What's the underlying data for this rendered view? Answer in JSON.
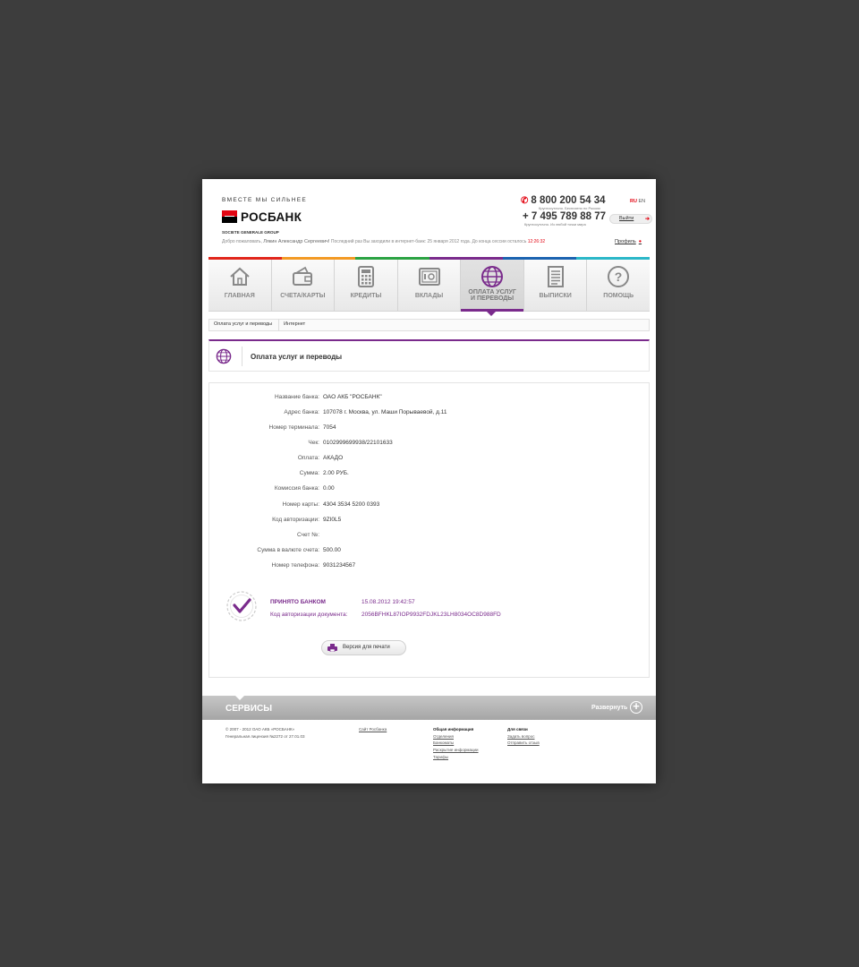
{
  "header": {
    "slogan": "ВМЕСТЕ МЫ СИЛЬНЕЕ",
    "logo_text": "РОСБАНК",
    "group": "SOCIETE GENERALE GROUP",
    "phone1": "8 800 200 54 34",
    "phone1_note": "Круглосуточно. Бесплатно по России",
    "phone2": "+ 7 495 789 88 77",
    "phone2_note": "Круглосуточно. Из любой точки мира",
    "lang_ru": "RU",
    "lang_en": "EN",
    "logout": "Выйти",
    "welcome_prefix": "Добро пожаловать,",
    "user_name": "Лякин Александр Сергеевич!",
    "last_login": "Последний раз Вы заходили в интернет-банк: 25 января 2012 года.",
    "session_label": "До конца сессии осталось",
    "session_time": "12:26:32",
    "profile": "Профиль"
  },
  "colors": {
    "accent": "#7a2b8c",
    "brand_red": "#e30613",
    "stripe": [
      "#e1261c",
      "#f39a24",
      "#2ca343",
      "#7a2b8c",
      "#1b63b0",
      "#2bb7c8"
    ]
  },
  "nav": [
    {
      "label": "ГЛАВНАЯ",
      "icon": "home-icon"
    },
    {
      "label": "СЧЕТА/КАРТЫ",
      "icon": "wallet-icon"
    },
    {
      "label": "КРЕДИТЫ",
      "icon": "calculator-icon"
    },
    {
      "label": "ВКЛАДЫ",
      "icon": "safe-icon"
    },
    {
      "label": "ОПЛАТА УСЛУГ",
      "label2": "И ПЕРЕВОДЫ",
      "icon": "globe-icon",
      "active": true
    },
    {
      "label": "ВЫПИСКИ",
      "icon": "document-icon"
    },
    {
      "label": "ПОМОЩЬ",
      "icon": "help-icon"
    }
  ],
  "breadcrumb": [
    "Оплата услуг и переводы",
    "Интернет"
  ],
  "section_title": "Оплата услуг и переводы",
  "receipt": [
    {
      "label": "Название банка:",
      "value": "ОАО АКБ \"РОСБАНК\""
    },
    {
      "label": "Адрес банка:",
      "value": "107078 г. Москва, ул. Маши Порываевой, д.11"
    },
    {
      "label": "Номер терминала:",
      "value": "7054"
    },
    {
      "label": "Чек:",
      "value": "0102999699938/22101633"
    },
    {
      "label": "Оплата:",
      "value": "АКАДО"
    },
    {
      "label": "Сумма:",
      "value": "2.00 РУБ."
    },
    {
      "label": "Комиссия банка:",
      "value": "0.00"
    },
    {
      "label": "Номер карты:",
      "value": "4304 3534 5200 0393"
    },
    {
      "label": "Код авторизации:",
      "value": "9ZI0L5"
    },
    {
      "label": "Счет №:",
      "value": ""
    },
    {
      "label": "Сумма в валюте счета:",
      "value": "500.00"
    },
    {
      "label": "Номер телефона:",
      "value": "9031234567"
    }
  ],
  "status": {
    "accepted_label": "ПРИНЯТО БАНКОМ",
    "accepted_date": "15.08.2012 19:42:57",
    "doc_code_label": "Код авторизации документа:",
    "doc_code": "2056BFHKL87IOP9932FDJKL23LH8034OC8D988FD"
  },
  "print_button": "Версия для печати",
  "services": {
    "title": "СЕРВИСЫ",
    "expand": "Развернуть"
  },
  "footer": {
    "copyright": "© 2007 - 2012 ОАО АКБ «РОСБАНК»",
    "license": "Генеральная лицензия №2272 от 27.01.03",
    "site_link": "Сайт Росбанка",
    "info_title": "Общая информация",
    "info_links": [
      "Отделения",
      "Банкоматы",
      "Раскрытие информации",
      "Тарифы"
    ],
    "contact_title": "Для связи",
    "contact_links": [
      "Задать вопрос",
      "Отправить отзыв"
    ]
  }
}
